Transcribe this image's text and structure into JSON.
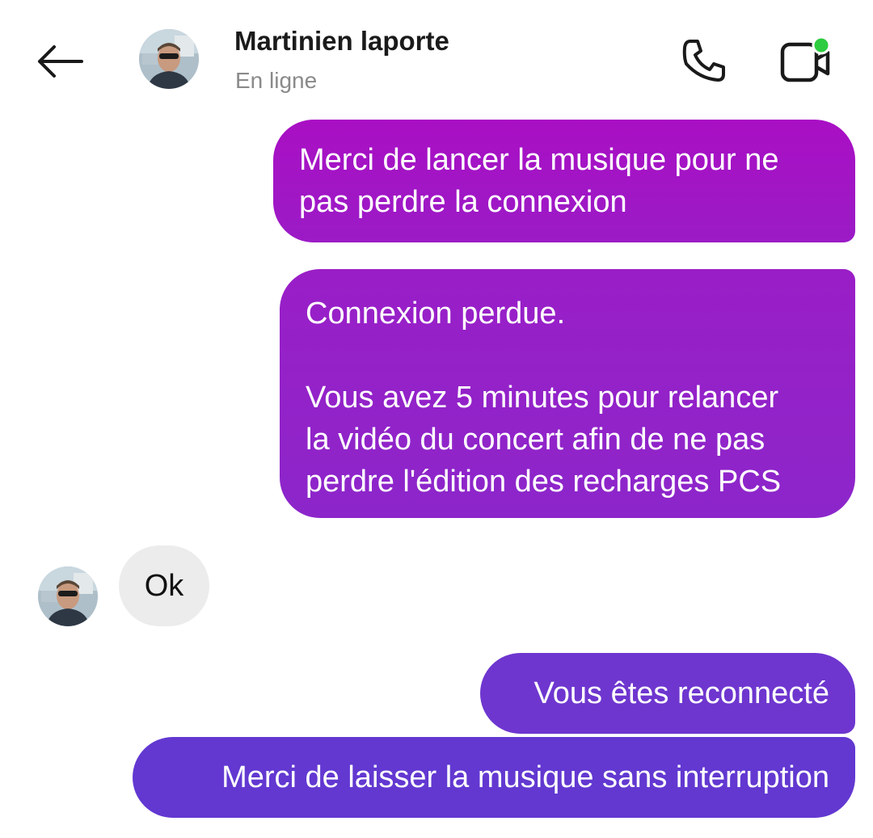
{
  "header": {
    "contact_name": "Martinien laporte",
    "status": "En ligne",
    "back_icon": "arrow-left-icon",
    "call_icon": "phone-icon",
    "video_icon": "video-camera-icon",
    "online_dot_color": "#2ecc40"
  },
  "messages": [
    {
      "direction": "out",
      "text": "Merci de lancer la musique pour ne\npas perdre la connexion"
    },
    {
      "direction": "out",
      "text": "Connexion perdue.\n\nVous avez 5 minutes pour relancer\nla vidéo du concert afin de ne pas\nperdre l'édition des recharges PCS"
    },
    {
      "direction": "in",
      "text": "Ok"
    },
    {
      "direction": "out",
      "text": "Vous êtes reconnecté"
    },
    {
      "direction": "out",
      "text": "Merci de laisser la musique sans interruption"
    }
  ],
  "colors": {
    "outgoing_top": "#a90fc4",
    "outgoing_bottom": "#6238d1",
    "incoming_bg": "#ececec",
    "status_text": "#8a8a8a"
  }
}
